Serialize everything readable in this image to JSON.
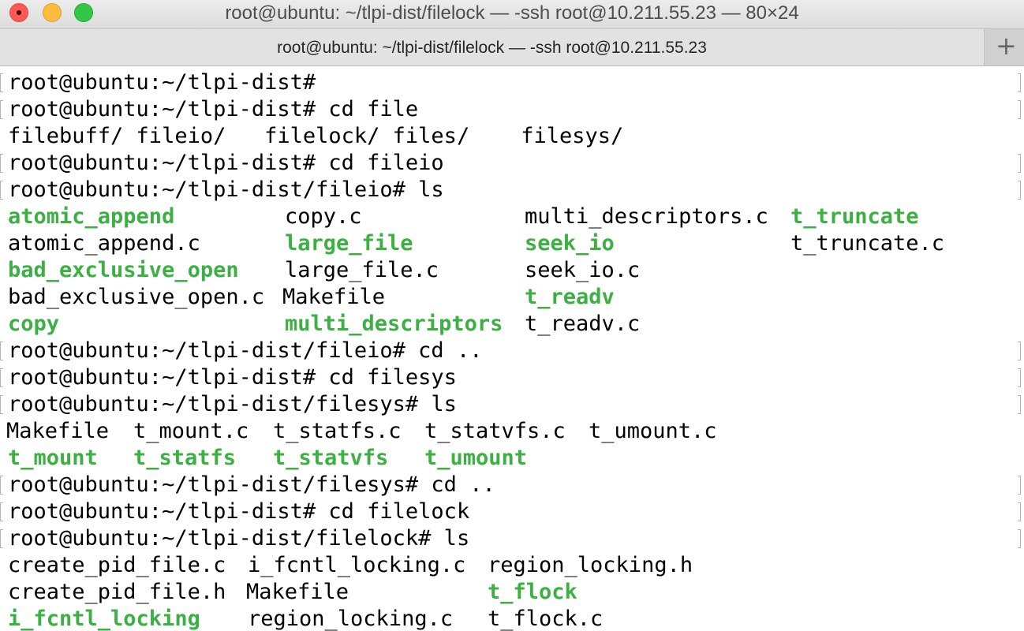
{
  "window": {
    "title": "root@ubuntu: ~/tlpi-dist/filelock — -ssh root@10.211.55.23 — 80×24",
    "close_icon": "close-icon",
    "minimize_icon": "minimize-icon",
    "zoom_icon": "zoom-icon"
  },
  "tab": {
    "title": "root@ubuntu: ~/tlpi-dist/filelock — -ssh root@10.211.55.23",
    "new_tab_glyph": "+"
  },
  "colors": {
    "executable": "#3cb043",
    "text": "#000000",
    "background": "#ffffff"
  },
  "terminal": {
    "lines": [
      {
        "marked": true,
        "segments": [
          {
            "text": "root@ubuntu:~/tlpi-dist#",
            "exe": false
          }
        ]
      },
      {
        "marked": true,
        "segments": [
          {
            "text": "root@ubuntu:~/tlpi-dist# cd file",
            "exe": false
          }
        ]
      },
      {
        "marked": false,
        "segments": [
          {
            "text": "filebuff/ fileio/   filelock/ files/    filesys/",
            "exe": false
          }
        ]
      },
      {
        "marked": true,
        "segments": [
          {
            "text": "root@ubuntu:~/tlpi-dist# cd fileio",
            "exe": false
          }
        ]
      },
      {
        "marked": true,
        "segments": [
          {
            "text": "root@ubuntu:~/tlpi-dist/fileio# ls",
            "exe": false
          }
        ]
      },
      {
        "marked": false,
        "segments": [
          {
            "text": "atomic_append",
            "exe": true
          },
          {
            "text": "copy.c",
            "exe": false
          },
          {
            "text": "multi_descriptors.c",
            "exe": false
          },
          {
            "text": "t_truncate",
            "exe": true
          }
        ]
      },
      {
        "marked": false,
        "segments": [
          {
            "text": "atomic_append.c",
            "exe": false
          },
          {
            "text": "large_file",
            "exe": true
          },
          {
            "text": "seek_io",
            "exe": true
          },
          {
            "text": "t_truncate.c",
            "exe": false
          }
        ]
      },
      {
        "marked": false,
        "segments": [
          {
            "text": "bad_exclusive_open",
            "exe": true
          },
          {
            "text": "large_file.c",
            "exe": false
          },
          {
            "text": "seek_io.c",
            "exe": false
          }
        ]
      },
      {
        "marked": false,
        "segments": [
          {
            "text": "bad_exclusive_open.c",
            "exe": false
          },
          {
            "text": "Makefile",
            "exe": false
          },
          {
            "text": "t_readv",
            "exe": true
          }
        ]
      },
      {
        "marked": false,
        "segments": [
          {
            "text": "copy",
            "exe": true
          },
          {
            "text": "multi_descriptors",
            "exe": true
          },
          {
            "text": "t_readv.c",
            "exe": false
          }
        ]
      },
      {
        "marked": true,
        "segments": [
          {
            "text": "root@ubuntu:~/tlpi-dist/fileio# cd ..",
            "exe": false
          }
        ]
      },
      {
        "marked": true,
        "segments": [
          {
            "text": "root@ubuntu:~/tlpi-dist# cd filesys",
            "exe": false
          }
        ]
      },
      {
        "marked": true,
        "segments": [
          {
            "text": "root@ubuntu:~/tlpi-dist/filesys# ls",
            "exe": false
          }
        ]
      },
      {
        "marked": false,
        "segments": [
          {
            "text": "Makefile",
            "exe": false
          },
          {
            "text": "t_mount.c",
            "exe": false
          },
          {
            "text": "t_statfs.c",
            "exe": false
          },
          {
            "text": "t_statvfs.c",
            "exe": false
          },
          {
            "text": "t_umount.c",
            "exe": false
          }
        ]
      },
      {
        "marked": false,
        "segments": [
          {
            "text": "t_mount",
            "exe": true
          },
          {
            "text": "t_statfs",
            "exe": true
          },
          {
            "text": "t_statvfs",
            "exe": true
          },
          {
            "text": "t_umount",
            "exe": true
          }
        ]
      },
      {
        "marked": true,
        "segments": [
          {
            "text": "root@ubuntu:~/tlpi-dist/filesys# cd ..",
            "exe": false
          }
        ]
      },
      {
        "marked": true,
        "segments": [
          {
            "text": "root@ubuntu:~/tlpi-dist# cd filelock",
            "exe": false
          }
        ]
      },
      {
        "marked": true,
        "segments": [
          {
            "text": "root@ubuntu:~/tlpi-dist/filelock# ls",
            "exe": false
          }
        ]
      },
      {
        "marked": false,
        "segments": [
          {
            "text": "create_pid_file.c",
            "exe": false
          },
          {
            "text": "i_fcntl_locking.c",
            "exe": false
          },
          {
            "text": "region_locking.h",
            "exe": false
          }
        ]
      },
      {
        "marked": false,
        "segments": [
          {
            "text": "create_pid_file.h",
            "exe": false
          },
          {
            "text": "Makefile",
            "exe": false
          },
          {
            "text": "t_flock",
            "exe": true
          }
        ]
      },
      {
        "marked": false,
        "segments": [
          {
            "text": "i_fcntl_locking",
            "exe": true
          },
          {
            "text": "region_locking.c",
            "exe": false
          },
          {
            "text": "t_flock.c",
            "exe": false
          }
        ]
      }
    ]
  }
}
